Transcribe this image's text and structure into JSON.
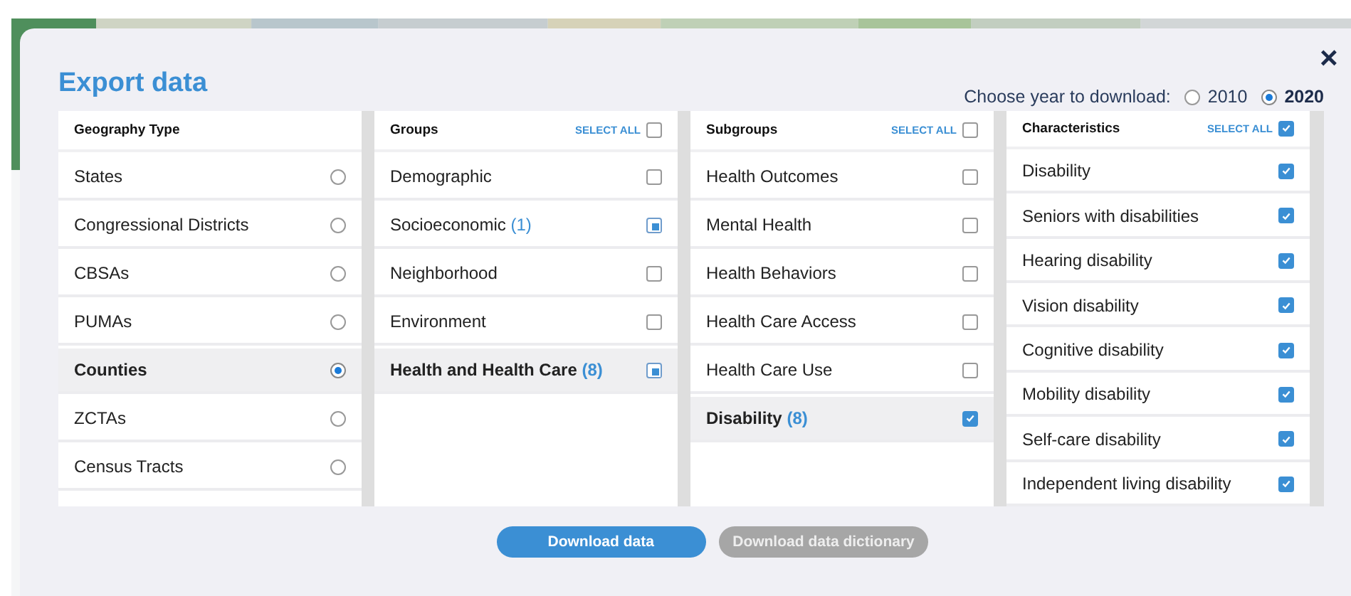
{
  "dialog": {
    "title": "Export data",
    "close": "×"
  },
  "year_chooser": {
    "label": "Choose year to download:",
    "options": [
      {
        "label": "2010",
        "selected": false
      },
      {
        "label": "2020",
        "selected": true
      }
    ]
  },
  "columns": [
    {
      "title": "Geography Type",
      "kind": "radio",
      "items": [
        {
          "label": "States",
          "selected": false
        },
        {
          "label": "Congressional Districts",
          "selected": false
        },
        {
          "label": "CBSAs",
          "selected": false
        },
        {
          "label": "PUMAs",
          "selected": false
        },
        {
          "label": "Counties",
          "selected": true
        },
        {
          "label": "ZCTAs",
          "selected": false
        },
        {
          "label": "Census Tracts",
          "selected": false
        }
      ]
    },
    {
      "title": "Groups",
      "kind": "checkbox",
      "select_all": {
        "label": "SELECT ALL",
        "checked": false
      },
      "items": [
        {
          "label": "Demographic",
          "selected": false,
          "checked": false,
          "partial": false
        },
        {
          "label": "Socioeconomic",
          "count": "(1)",
          "selected": false,
          "checked": true,
          "partial": true
        },
        {
          "label": "Neighborhood",
          "selected": false,
          "checked": false,
          "partial": false
        },
        {
          "label": "Environment",
          "selected": false,
          "checked": false,
          "partial": false
        },
        {
          "label": "Health and Health Care",
          "count": "(8)",
          "selected": true,
          "checked": true,
          "partial": true
        }
      ]
    },
    {
      "title": "Subgroups",
      "kind": "checkbox",
      "select_all": {
        "label": "SELECT ALL",
        "checked": false
      },
      "items": [
        {
          "label": "Health Outcomes",
          "selected": false,
          "checked": false,
          "partial": false
        },
        {
          "label": "Mental Health",
          "selected": false,
          "checked": false,
          "partial": false
        },
        {
          "label": "Health Behaviors",
          "selected": false,
          "checked": false,
          "partial": false
        },
        {
          "label": "Health Care Access",
          "selected": false,
          "checked": false,
          "partial": false
        },
        {
          "label": "Health Care Use",
          "selected": false,
          "checked": false,
          "partial": false
        },
        {
          "label": "Disability",
          "count": "(8)",
          "selected": true,
          "checked": true,
          "partial": false
        }
      ]
    },
    {
      "title": "Characteristics",
      "kind": "checkbox",
      "select_all": {
        "label": "SELECT ALL",
        "checked": true
      },
      "items": [
        {
          "label": "Disability",
          "selected": false,
          "checked": true,
          "partial": false
        },
        {
          "label": "Seniors with disabilities",
          "selected": false,
          "checked": true,
          "partial": false
        },
        {
          "label": "Hearing disability",
          "selected": false,
          "checked": true,
          "partial": false
        },
        {
          "label": "Vision disability",
          "selected": false,
          "checked": true,
          "partial": false
        },
        {
          "label": "Cognitive disability",
          "selected": false,
          "checked": true,
          "partial": false
        },
        {
          "label": "Mobility disability",
          "selected": false,
          "checked": true,
          "partial": false
        },
        {
          "label": "Self-care disability",
          "selected": false,
          "checked": true,
          "partial": false
        },
        {
          "label": "Independent living disability",
          "selected": false,
          "checked": true,
          "partial": false
        }
      ]
    }
  ],
  "buttons": [
    {
      "label": "Download data",
      "disabled": false
    },
    {
      "label": "Download data dictionary",
      "disabled": true
    }
  ]
}
